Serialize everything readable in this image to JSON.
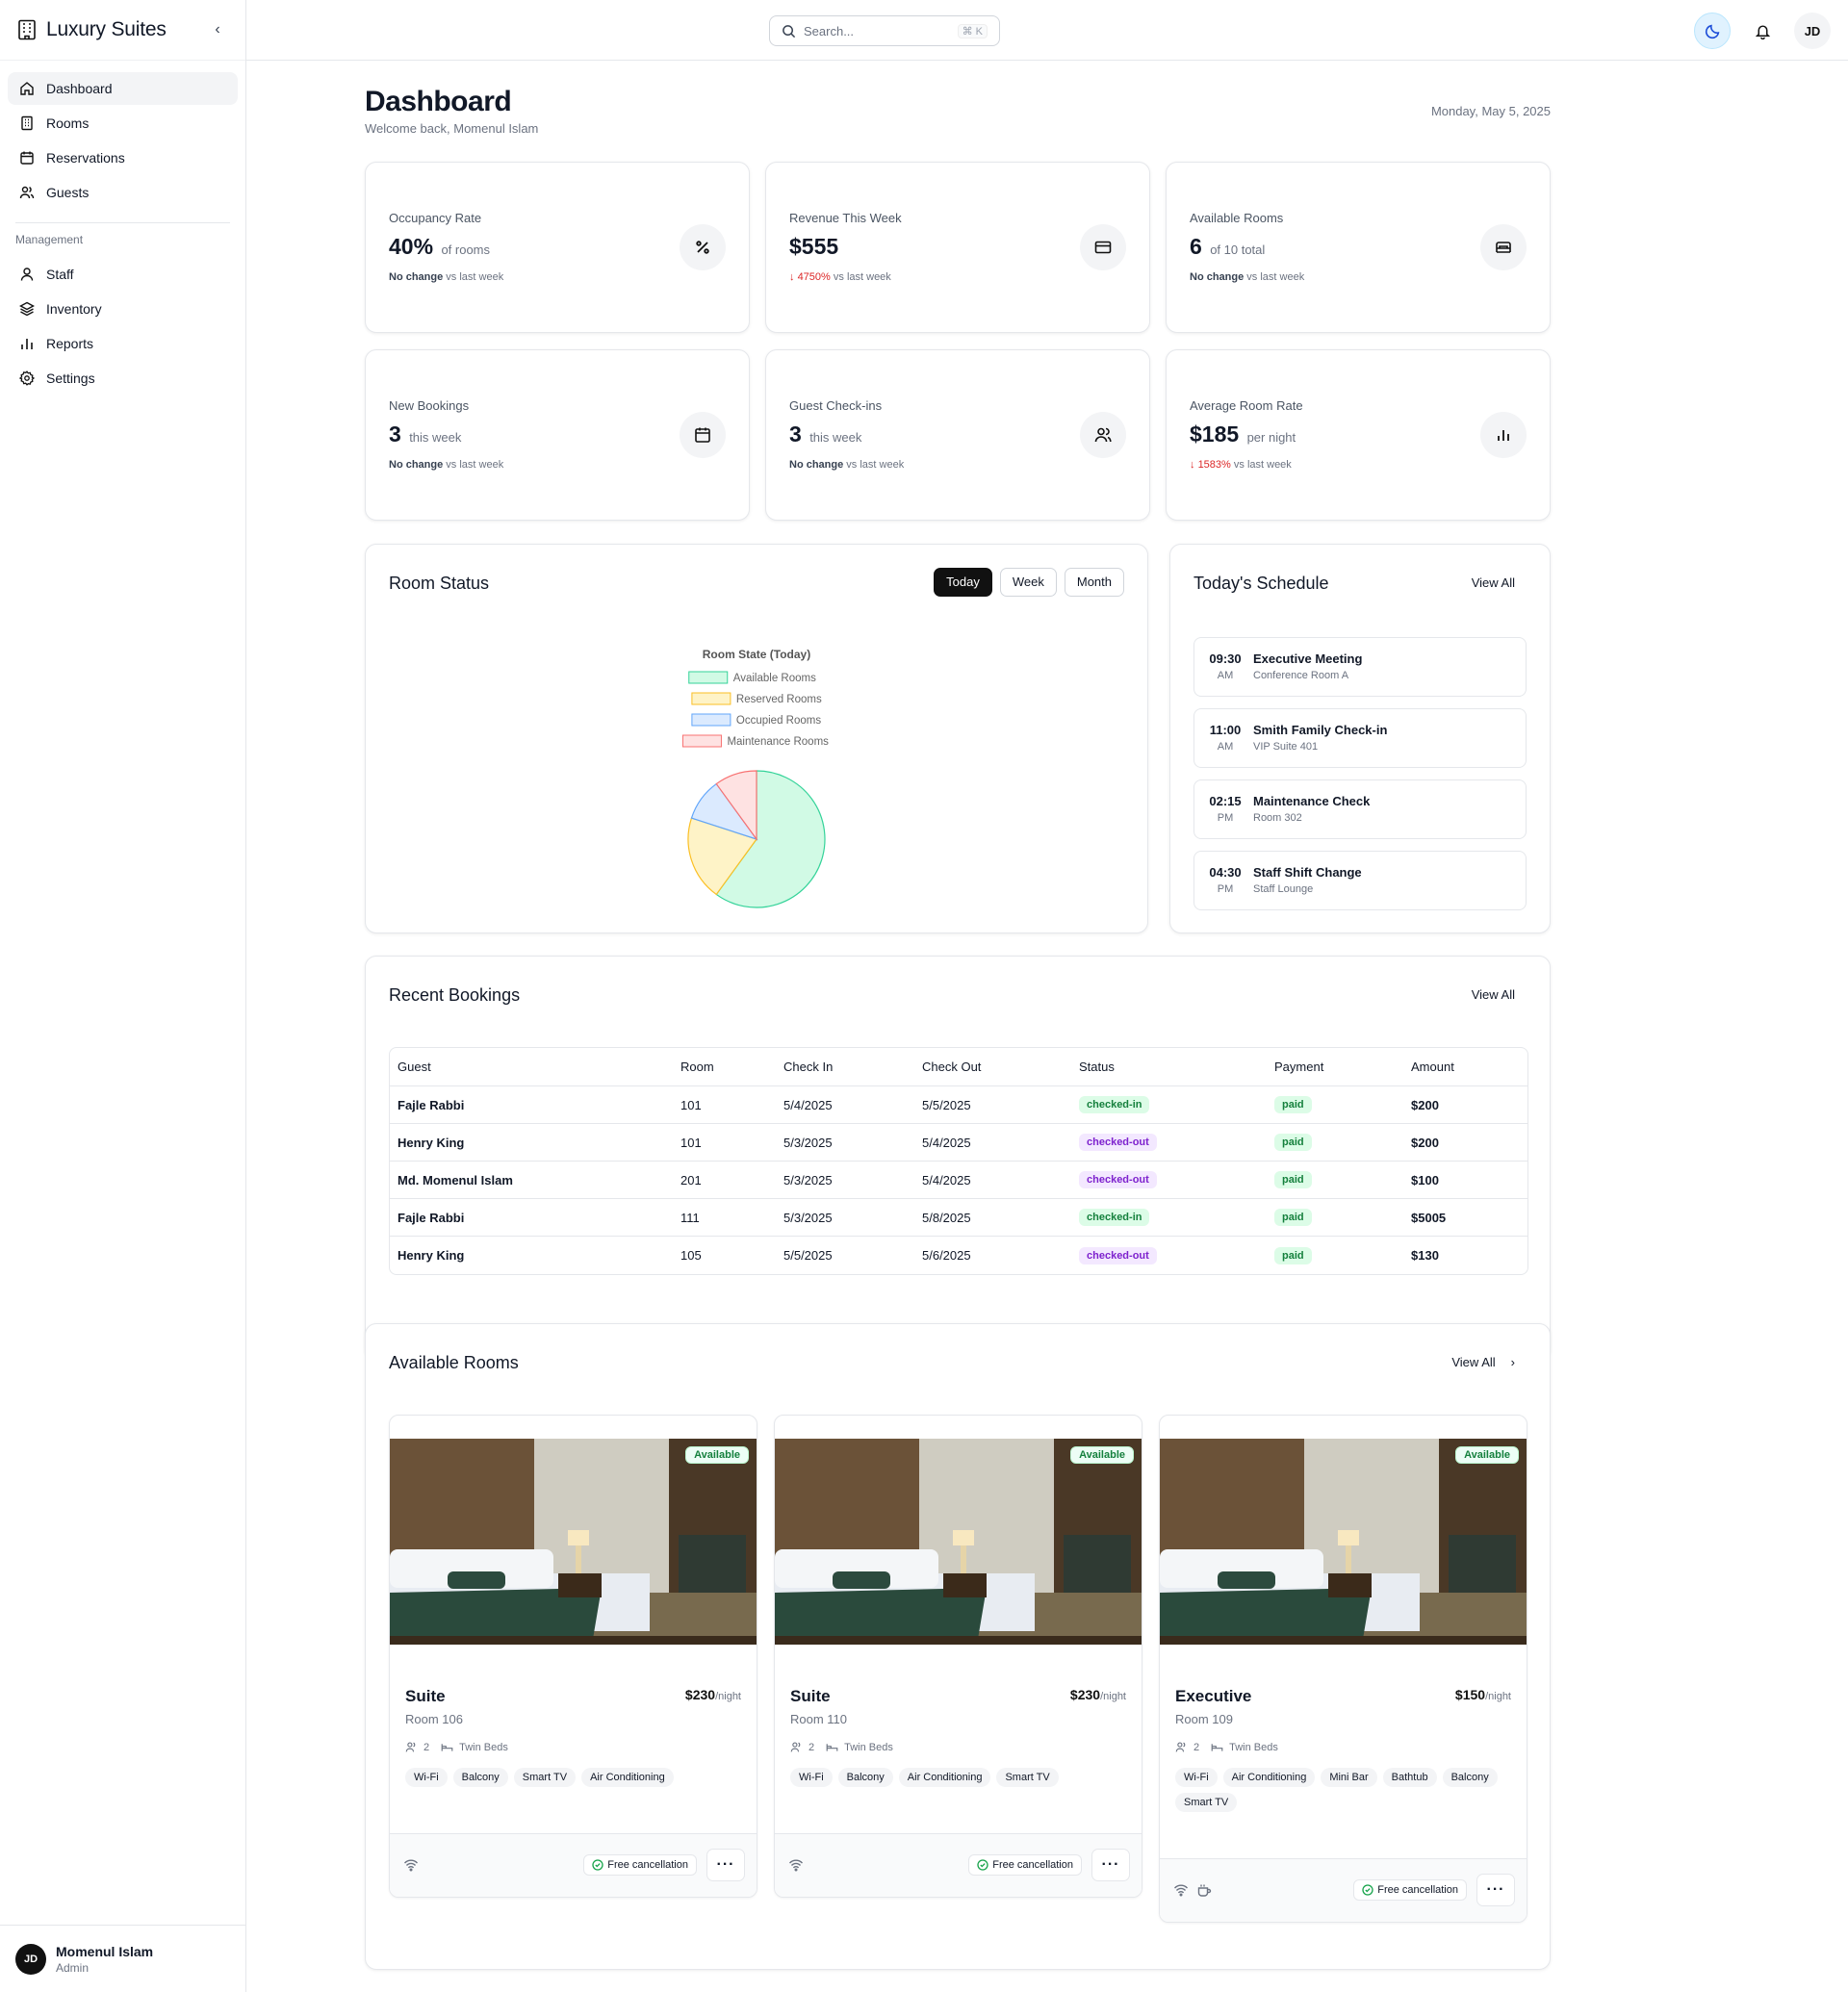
{
  "brand": {
    "name": "Luxury Suites"
  },
  "sidebar": {
    "items": [
      {
        "label": "Dashboard",
        "icon": "home-icon",
        "active": true
      },
      {
        "label": "Rooms",
        "icon": "building-icon"
      },
      {
        "label": "Reservations",
        "icon": "calendar-icon"
      },
      {
        "label": "Guests",
        "icon": "users-icon"
      }
    ],
    "section_label": "Management",
    "mgmt_items": [
      {
        "label": "Staff",
        "icon": "user-icon"
      },
      {
        "label": "Inventory",
        "icon": "layers-icon"
      },
      {
        "label": "Reports",
        "icon": "bar-chart-icon"
      },
      {
        "label": "Settings",
        "icon": "gear-icon"
      }
    ],
    "user": {
      "initials": "JD",
      "name": "Momenul Islam",
      "role": "Admin"
    }
  },
  "topbar": {
    "search_placeholder": "Search...",
    "search_shortcut": "⌘ K",
    "avatar_initials": "JD"
  },
  "header": {
    "title": "Dashboard",
    "subtitle": "Welcome back, Momenul Islam",
    "date": "Monday, May 5, 2025"
  },
  "stats": [
    {
      "label": "Occupancy Rate",
      "value": "40%",
      "unit": "of rooms",
      "change_strong": "No change",
      "change_text": "vs last week",
      "icon": "percent-icon"
    },
    {
      "label": "Revenue This Week",
      "value": "$555",
      "unit": "",
      "change_down": "4750%",
      "change_text": "vs last week",
      "icon": "credit-card-icon"
    },
    {
      "label": "Available Rooms",
      "value": "6",
      "unit": "of 10 total",
      "change_strong": "No change",
      "change_text": "vs last week",
      "icon": "bed-icon"
    },
    {
      "label": "New Bookings",
      "value": "3",
      "unit": "this week",
      "change_strong": "No change",
      "change_text": "vs last week",
      "icon": "calendar-icon"
    },
    {
      "label": "Guest Check-ins",
      "value": "3",
      "unit": "this week",
      "change_strong": "No change",
      "change_text": "vs last week",
      "icon": "users-icon"
    },
    {
      "label": "Average Room Rate",
      "value": "$185",
      "unit": "per night",
      "change_down": "1583%",
      "change_text": "vs last week",
      "icon": "bar-chart-icon"
    }
  ],
  "room_status": {
    "title": "Room Status",
    "tabs": [
      "Today",
      "Week",
      "Month"
    ],
    "active_tab": "Today"
  },
  "chart_data": {
    "type": "pie",
    "title": "Room State (Today)",
    "categories": [
      "Available Rooms",
      "Reserved Rooms",
      "Occupied Rooms",
      "Maintenance Rooms"
    ],
    "values": [
      6,
      2,
      1,
      1
    ],
    "colors": {
      "fill": [
        "#d1fae5",
        "#fef3c7",
        "#dbeafe",
        "#fee2e2"
      ],
      "stroke": [
        "#34d399",
        "#fbbf24",
        "#60a5fa",
        "#f87171"
      ]
    },
    "legend": "top"
  },
  "schedule": {
    "title": "Today's Schedule",
    "view_all": "View All",
    "items": [
      {
        "time": "09:30",
        "ampm": "AM",
        "title": "Executive Meeting",
        "location": "Conference Room A"
      },
      {
        "time": "11:00",
        "ampm": "AM",
        "title": "Smith Family Check-in",
        "location": "VIP Suite 401"
      },
      {
        "time": "02:15",
        "ampm": "PM",
        "title": "Maintenance Check",
        "location": "Room 302"
      },
      {
        "time": "04:30",
        "ampm": "PM",
        "title": "Staff Shift Change",
        "location": "Staff Lounge"
      }
    ]
  },
  "bookings": {
    "title": "Recent Bookings",
    "view_all": "View All",
    "columns": [
      "Guest",
      "Room",
      "Check In",
      "Check Out",
      "Status",
      "Payment",
      "Amount"
    ],
    "rows": [
      {
        "guest": "Fajle Rabbi",
        "room": "101",
        "check_in": "5/4/2025",
        "check_out": "5/5/2025",
        "status": "checked-in",
        "payment": "paid",
        "amount": "$200"
      },
      {
        "guest": "Henry King",
        "room": "101",
        "check_in": "5/3/2025",
        "check_out": "5/4/2025",
        "status": "checked-out",
        "payment": "paid",
        "amount": "$200"
      },
      {
        "guest": "Md. Momenul Islam",
        "room": "201",
        "check_in": "5/3/2025",
        "check_out": "5/4/2025",
        "status": "checked-out",
        "payment": "paid",
        "amount": "$100"
      },
      {
        "guest": "Fajle Rabbi",
        "room": "111",
        "check_in": "5/3/2025",
        "check_out": "5/8/2025",
        "status": "checked-in",
        "payment": "paid",
        "amount": "$5005"
      },
      {
        "guest": "Henry King",
        "room": "105",
        "check_in": "5/5/2025",
        "check_out": "5/6/2025",
        "status": "checked-out",
        "payment": "paid",
        "amount": "$130"
      }
    ]
  },
  "available_rooms": {
    "title": "Available Rooms",
    "view_all": "View All",
    "rooms": [
      {
        "badge": "Available",
        "type": "Suite",
        "number": "Room 106",
        "price": "$230",
        "per": "/night",
        "guests": "2",
        "beds": "Twin Beds",
        "amenities": [
          "Wi-Fi",
          "Balcony",
          "Smart TV",
          "Air Conditioning"
        ],
        "icons": [
          "wifi-icon"
        ],
        "cancel": "Free cancellation"
      },
      {
        "badge": "Available",
        "type": "Suite",
        "number": "Room 110",
        "price": "$230",
        "per": "/night",
        "guests": "2",
        "beds": "Twin Beds",
        "amenities": [
          "Wi-Fi",
          "Balcony",
          "Air Conditioning",
          "Smart TV"
        ],
        "icons": [
          "wifi-icon"
        ],
        "cancel": "Free cancellation"
      },
      {
        "badge": "Available",
        "type": "Executive",
        "number": "Room 109",
        "price": "$150",
        "per": "/night",
        "guests": "2",
        "beds": "Twin Beds",
        "amenities": [
          "Wi-Fi",
          "Air Conditioning",
          "Mini Bar",
          "Bathtub",
          "Balcony",
          "Smart TV"
        ],
        "icons": [
          "wifi-icon",
          "coffee-icon"
        ],
        "cancel": "Free cancellation"
      }
    ]
  }
}
